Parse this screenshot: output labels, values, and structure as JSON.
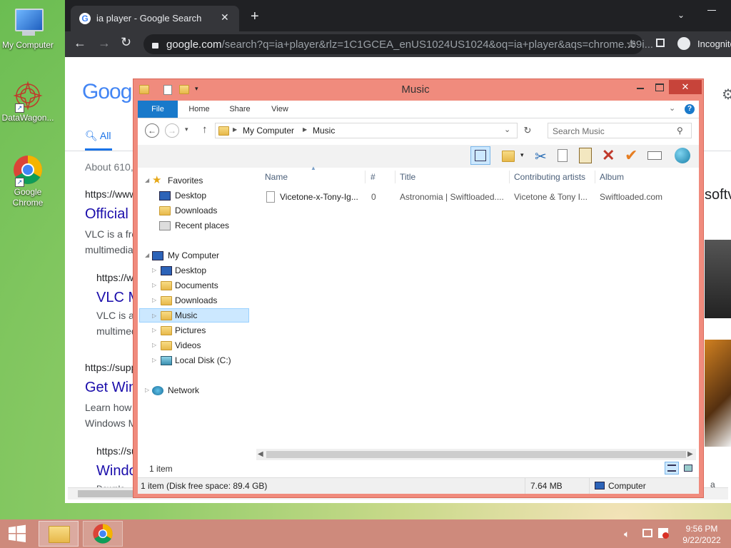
{
  "desktop": {
    "icons": [
      {
        "label": "My Computer"
      },
      {
        "label": "DataWagon..."
      },
      {
        "label": "Google Chrome"
      }
    ]
  },
  "chrome": {
    "tab_title": "ia player - Google Search",
    "url_main": "google.com",
    "url_rest": "/search?q=ia+player&rlz=1C1GCEA_enUS1024US1024&oq=ia+player&aqs=chrome..69i...",
    "incognito_label": "Incognito",
    "new_tab": "+",
    "page": {
      "logo": "Goog",
      "tab_all": "All",
      "about": "About 610,",
      "results": [
        {
          "url": "https://www",
          "title": "Official",
          "snip1": "VLC is a fre",
          "snip2": "multimedia"
        },
        {
          "url": "https://w",
          "title": "VLC M",
          "snip1": "VLC is a",
          "snip2": "multimed"
        },
        {
          "url": "https://supp",
          "title": "Get Win",
          "snip1": "Learn how",
          "snip2": "Windows M"
        },
        {
          "url": "https://su",
          "title": "Windo",
          "snip1": "Downlo",
          "snip2": ""
        }
      ],
      "right_fragment": "softv",
      "right_fragment2": "a type"
    }
  },
  "explorer": {
    "title": "Music",
    "ribbon_tabs": [
      "File",
      "Home",
      "Share",
      "View"
    ],
    "breadcrumb": [
      "My Computer",
      "Music"
    ],
    "search_placeholder": "Search Music",
    "columns": {
      "name": "Name",
      "num": "#",
      "title": "Title",
      "artists": "Contributing artists",
      "album": "Album"
    },
    "files": [
      {
        "name": "Vicetone-x-Tony-Ig...",
        "num": "0",
        "title": "Astronomia | Swiftloaded....",
        "artists": "Vicetone & Tony I...",
        "album": "Swiftloaded.com"
      }
    ],
    "nav": {
      "favorites": "Favorites",
      "fav_items": [
        "Desktop",
        "Downloads",
        "Recent places"
      ],
      "computer": "My Computer",
      "computer_items": [
        "Desktop",
        "Documents",
        "Downloads",
        "Music",
        "Pictures",
        "Videos",
        "Local Disk (C:)"
      ],
      "network": "Network"
    },
    "item_count": "1 item",
    "status_left": "1 item (Disk free space: 89.4 GB)",
    "status_size": "7.64 MB",
    "status_location": "Computer"
  },
  "taskbar": {
    "time": "9:56 PM",
    "date": "9/22/2022"
  },
  "colors": {
    "explorer_frame": "#f08b7d",
    "taskbar": "#ce8a7c",
    "file_tab": "#1979ca",
    "selection": "#cce8ff"
  }
}
